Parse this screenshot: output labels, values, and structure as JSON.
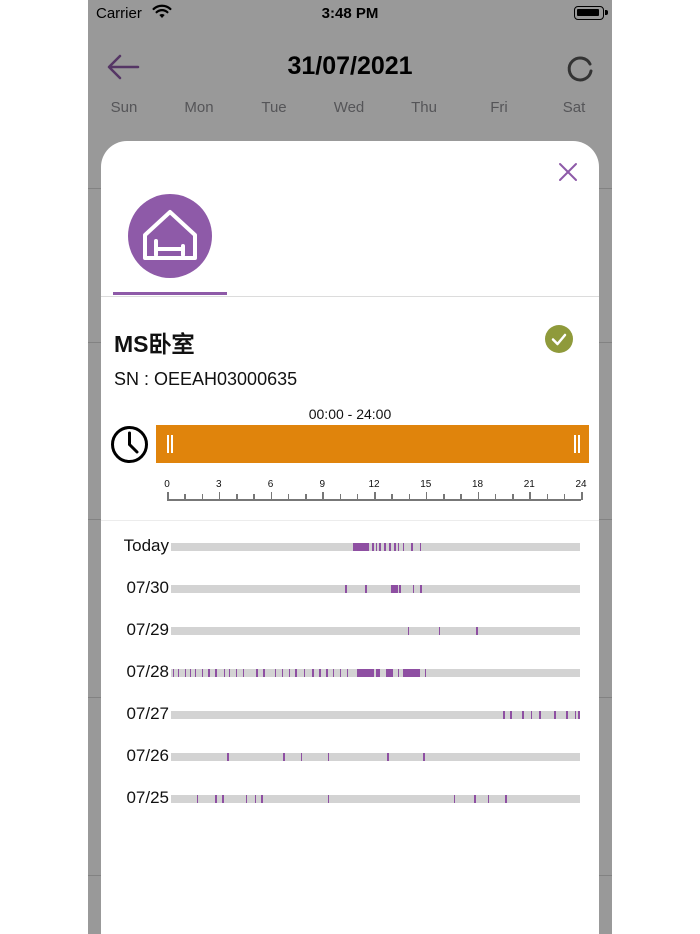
{
  "status_bar": {
    "carrier": "Carrier",
    "time": "3:48 PM"
  },
  "header": {
    "title": "31/07/2021"
  },
  "weekdays": [
    "Sun",
    "Mon",
    "Tue",
    "Wed",
    "Thu",
    "Fri",
    "Sat"
  ],
  "modal": {
    "device_name": "MS卧室",
    "serial": "SN : OEEAH03000635",
    "time_range": "00:00 - 24:00",
    "range_start_hour": 0,
    "range_end_hour": 24,
    "scale_ticks": [
      "0",
      "3",
      "6",
      "9",
      "12",
      "15",
      "18",
      "21",
      "24"
    ],
    "colors": {
      "accent": "#8e5aa8",
      "range_bar": "#e0840c",
      "ok": "#8f9a3b",
      "activity": "#8e4fa2"
    },
    "days": [
      {
        "label": "Today",
        "events": [
          [
            10.7,
            0.7
          ],
          [
            11.4,
            0.2
          ],
          [
            11.8,
            0.1
          ],
          [
            12.0,
            0.1
          ],
          [
            12.2,
            0.1
          ],
          [
            12.5,
            0.1
          ],
          [
            12.8,
            0.1
          ],
          [
            13.1,
            0.1
          ],
          [
            13.3,
            0.1
          ],
          [
            13.6,
            0.1
          ],
          [
            14.1,
            0.05
          ],
          [
            14.6,
            0.05
          ]
        ]
      },
      {
        "label": "07/30",
        "events": [
          [
            10.2,
            0.15
          ],
          [
            11.4,
            0.05
          ],
          [
            12.9,
            0.4
          ],
          [
            13.4,
            0.1
          ],
          [
            14.2,
            0.05
          ],
          [
            14.6,
            0.1
          ]
        ]
      },
      {
        "label": "07/29",
        "events": [
          [
            13.9,
            0.05
          ],
          [
            15.7,
            0.05
          ],
          [
            17.9,
            0.05
          ]
        ]
      },
      {
        "label": "07/28",
        "events": [
          [
            0.1,
            0.05
          ],
          [
            0.4,
            0.05
          ],
          [
            0.8,
            0.05
          ],
          [
            1.1,
            0.05
          ],
          [
            1.4,
            0.05
          ],
          [
            1.8,
            0.05
          ],
          [
            2.2,
            0.05
          ],
          [
            2.6,
            0.05
          ],
          [
            3.1,
            0.05
          ],
          [
            3.4,
            0.05
          ],
          [
            3.8,
            0.05
          ],
          [
            4.2,
            0.1
          ],
          [
            5.0,
            0.1
          ],
          [
            5.4,
            0.05
          ],
          [
            6.1,
            0.05
          ],
          [
            6.5,
            0.05
          ],
          [
            6.9,
            0.05
          ],
          [
            7.3,
            0.1
          ],
          [
            7.8,
            0.05
          ],
          [
            8.3,
            0.05
          ],
          [
            8.7,
            0.05
          ],
          [
            9.1,
            0.05
          ],
          [
            9.5,
            0.05
          ],
          [
            9.9,
            0.05
          ],
          [
            10.3,
            0.05
          ],
          [
            10.9,
            1.0
          ],
          [
            12.0,
            0.25
          ],
          [
            12.6,
            0.4
          ],
          [
            13.3,
            0.05
          ],
          [
            13.6,
            1.0
          ],
          [
            14.9,
            0.05
          ]
        ]
      },
      {
        "label": "07/27",
        "events": [
          [
            19.5,
            0.05
          ],
          [
            19.9,
            0.05
          ],
          [
            20.6,
            0.05
          ],
          [
            21.1,
            0.05
          ],
          [
            21.6,
            0.05
          ],
          [
            22.5,
            0.05
          ],
          [
            23.2,
            0.05
          ],
          [
            23.7,
            0.05
          ],
          [
            23.9,
            0.05
          ]
        ]
      },
      {
        "label": "07/26",
        "events": [
          [
            3.3,
            0.05
          ],
          [
            6.6,
            0.05
          ],
          [
            7.6,
            0.05
          ],
          [
            9.2,
            0.05
          ],
          [
            12.7,
            0.05
          ],
          [
            14.8,
            0.05
          ]
        ]
      },
      {
        "label": "07/25",
        "events": [
          [
            1.5,
            0.05
          ],
          [
            2.6,
            0.05
          ],
          [
            3.0,
            0.05
          ],
          [
            4.4,
            0.05
          ],
          [
            4.9,
            0.05
          ],
          [
            5.3,
            0.05
          ],
          [
            9.2,
            0.05
          ],
          [
            16.6,
            0.05
          ],
          [
            17.8,
            0.05
          ],
          [
            18.6,
            0.05
          ],
          [
            19.6,
            0.05
          ]
        ]
      }
    ]
  }
}
